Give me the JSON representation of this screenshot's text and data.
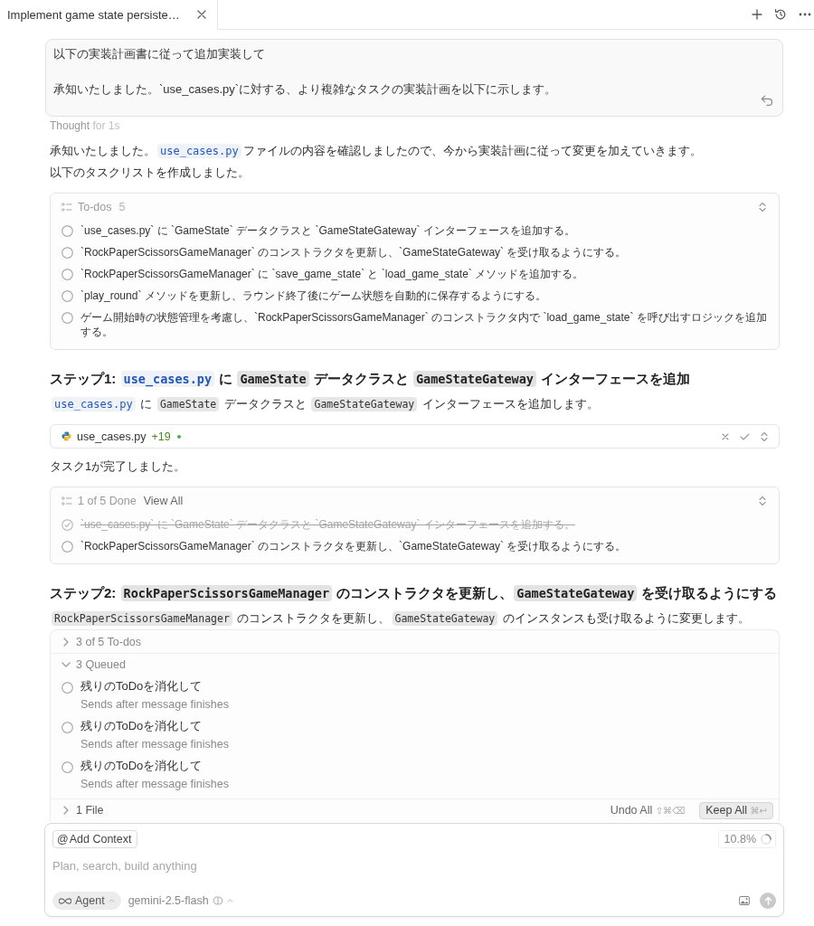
{
  "tabs": [
    {
      "label": "Implement game state persiste…",
      "selected": true
    }
  ],
  "user_message": {
    "paragraphs": [
      "以下の実装計画書に従って追加実装して",
      "承知いたしました。`use_cases.py`に対する、より複雑なタスクの実装計画を以下に示します。"
    ]
  },
  "thought": {
    "label": "Thought",
    "detail": "for 1s"
  },
  "blocks": [
    {
      "kind": "paragraph",
      "segments": [
        {
          "kind": "text",
          "text": "承知いたしました。"
        },
        {
          "kind": "file_ref",
          "text": "use_cases.py"
        },
        {
          "kind": "text",
          "text": "ファイルの内容を確認しましたので、今から実装計画に従って変更を加えていきます。"
        }
      ]
    },
    {
      "kind": "paragraph",
      "segments": [
        {
          "kind": "text",
          "text": "以下のタスクリストを作成しました。"
        }
      ]
    },
    {
      "kind": "todo_list",
      "title": "To-dos",
      "count": "5",
      "items": [
        {
          "text": "`use_cases.py` に `GameState` データクラスと `GameStateGateway` インターフェースを追加する。",
          "checked": false
        },
        {
          "text": "`RockPaperScissorsGameManager` のコンストラクタを更新し、`GameStateGateway` を受け取るようにする。",
          "checked": false
        },
        {
          "text": "`RockPaperScissorsGameManager` に `save_game_state` と `load_game_state` メソッドを追加する。",
          "checked": false
        },
        {
          "text": "`play_round` メソッドを更新し、ラウンド終了後にゲーム状態を自動的に保存するようにする。",
          "checked": false
        },
        {
          "text": "ゲーム開始時の状態管理を考慮し、`RockPaperScissorsGameManager` のコンストラクタ内で `load_game_state` を呼び出すロジックを追加する。",
          "checked": false
        }
      ]
    },
    {
      "kind": "heading",
      "segments": [
        {
          "kind": "text",
          "text": "ステップ1: "
        },
        {
          "kind": "file_ref",
          "text": "use_cases.py"
        },
        {
          "kind": "text",
          "text": " に "
        },
        {
          "kind": "code",
          "text": "GameState"
        },
        {
          "kind": "text",
          "text": " データクラスと "
        },
        {
          "kind": "code",
          "text": "GameStateGateway"
        },
        {
          "kind": "text",
          "text": " インターフェースを追加"
        }
      ]
    },
    {
      "kind": "paragraph",
      "segments": [
        {
          "kind": "file_ref",
          "text": "use_cases.py"
        },
        {
          "kind": "text",
          "text": " に "
        },
        {
          "kind": "code",
          "text": "GameState"
        },
        {
          "kind": "text",
          "text": " データクラスと "
        },
        {
          "kind": "code",
          "text": "GameStateGateway"
        },
        {
          "kind": "text",
          "text": " インターフェースを追加します。"
        }
      ]
    },
    {
      "kind": "file_change",
      "file": "use_cases.py",
      "additions": "+19"
    },
    {
      "kind": "paragraph",
      "segments": [
        {
          "kind": "text",
          "text": "タスク1が完了しました。"
        }
      ]
    },
    {
      "kind": "todo_progress",
      "summary": "1 of 5 Done",
      "link": "View All",
      "items": [
        {
          "text": "`use_cases.py` に `GameState` データクラスと `GameStateGateway` インターフェースを追加する。",
          "checked": true
        },
        {
          "text": "`RockPaperScissorsGameManager` のコンストラクタを更新し、`GameStateGateway` を受け取るようにする。",
          "checked": false
        }
      ]
    },
    {
      "kind": "heading",
      "segments": [
        {
          "kind": "text",
          "text": "ステップ2: "
        },
        {
          "kind": "code",
          "text": "RockPaperScissorsGameManager"
        },
        {
          "kind": "text",
          "text": " のコンストラクタを更新し、"
        },
        {
          "kind": "code",
          "text": "GameStateGateway"
        },
        {
          "kind": "text",
          "text": " を受け取るようにする"
        }
      ]
    },
    {
      "kind": "paragraph",
      "segments": [
        {
          "kind": "code",
          "text": "RockPaperScissorsGameManager"
        },
        {
          "kind": "text",
          "text": " のコンストラクタを更新し、"
        },
        {
          "kind": "code",
          "text": "GameStateGateway"
        },
        {
          "kind": "text",
          "text": " のインスタンスも受け取るように変更します。"
        }
      ]
    }
  ],
  "pending": {
    "sections": [
      {
        "label": "3 of 5 To-dos",
        "expanded": false
      },
      {
        "label": "3 Queued",
        "expanded": true,
        "items": [
          {
            "text": "残りのToDoを消化して",
            "note": "Sends after message finishes",
            "checked": false
          },
          {
            "text": "残りのToDoを消化して",
            "note": "Sends after message finishes",
            "checked": false
          },
          {
            "text": "残りのToDoを消化して",
            "note": "Sends after message finishes",
            "checked": false
          }
        ]
      },
      {
        "label": "1 File",
        "expanded": false,
        "actions": [
          {
            "label": "Undo All",
            "shortcut": "⇧⌘⌫",
            "kind": "secondary"
          },
          {
            "label": "Keep All",
            "shortcut": "⌘↩",
            "kind": "primary"
          }
        ]
      }
    ]
  },
  "composer": {
    "context_button": {
      "symbol": "@",
      "label": "Add Context"
    },
    "usage": "10.8%",
    "placeholder": "Plan, search, build anything",
    "mode": "Agent",
    "model": "gemini-2.5-flash"
  }
}
